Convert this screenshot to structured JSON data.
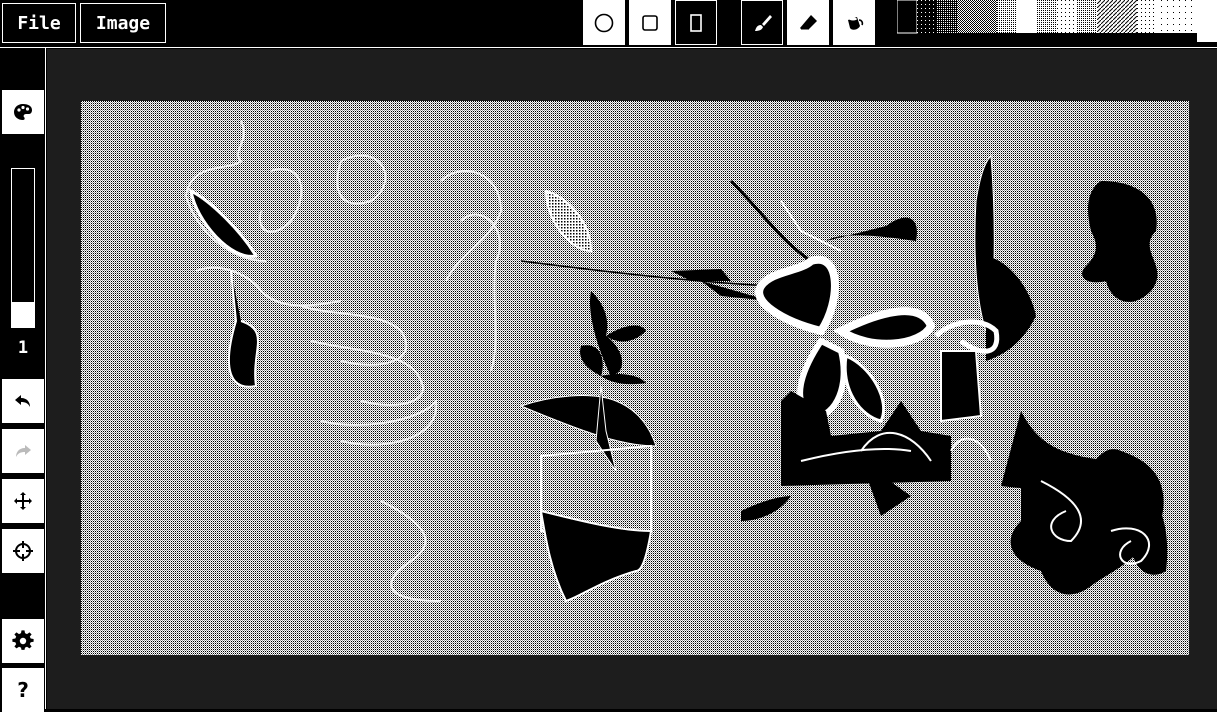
{
  "menu": {
    "file_label": "File",
    "image_label": "Image"
  },
  "tools": [
    {
      "name": "ellipse-tool",
      "icon": "circle-icon",
      "active": false
    },
    {
      "name": "rectangle-tool",
      "icon": "square-icon",
      "active": false
    },
    {
      "name": "rectangle-fill-tool",
      "icon": "tall-rectangle-icon",
      "active": true
    },
    {
      "name": "brush-tool",
      "icon": "brush-icon",
      "active": true
    },
    {
      "name": "eraser-tool",
      "icon": "eraser-icon",
      "active": false
    },
    {
      "name": "bucket-tool",
      "icon": "paint-bucket-icon",
      "active": false
    }
  ],
  "brush": {
    "size_value": "1",
    "size_level": 0.16
  },
  "sidebar": {
    "help_label": "?"
  },
  "colors": {
    "background": "#000000",
    "workspace": "#1d1d1d",
    "foreground": "#ffffff"
  }
}
